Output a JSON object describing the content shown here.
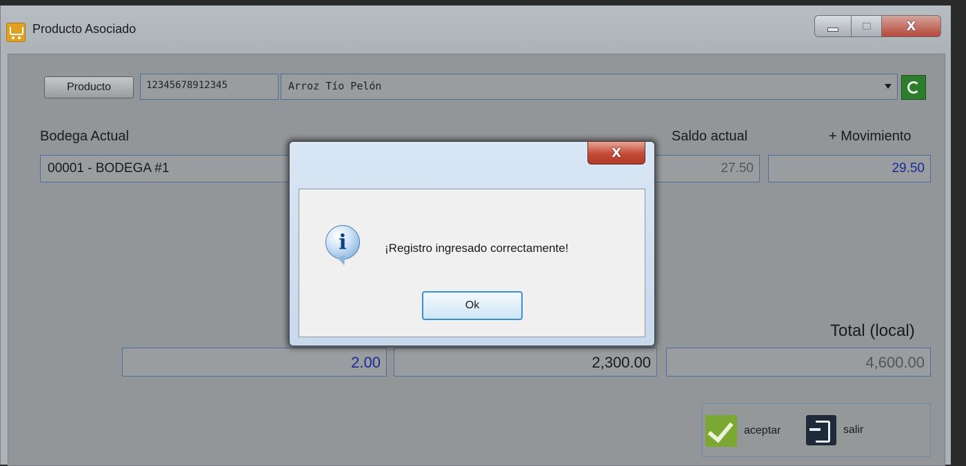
{
  "window": {
    "title": "Producto Asociado",
    "close_glyph": "X"
  },
  "product": {
    "button_label": "Producto",
    "code": "12345678912345",
    "name": "Arroz Tío Pelón"
  },
  "labels": {
    "bodega_actual": "Bodega Actual",
    "saldo_actual": "Saldo actual",
    "movimiento": "+ Movimiento",
    "total_local": "Total (local)"
  },
  "values": {
    "bodega": "00001 - BODEGA #1",
    "saldo": "27.50",
    "movimiento": "29.50",
    "cantidad": "2.00",
    "precio": "2,300.00",
    "total": "4,600.00"
  },
  "actions": {
    "aceptar": "aceptar",
    "salir": "salir"
  },
  "dialog": {
    "close_glyph": "X",
    "info_glyph": "i",
    "message": "¡Registro ingresado correctamente!",
    "ok_label": "Ok"
  },
  "icons": {
    "app": "shopping-cart-icon",
    "refresh": "refresh-icon",
    "accept": "checkmark-icon",
    "exit": "exit-icon",
    "info": "info-icon"
  },
  "colors": {
    "value_blue": "#1a2a9a",
    "accept_green": "#7aa832",
    "close_red": "#c24a36"
  }
}
